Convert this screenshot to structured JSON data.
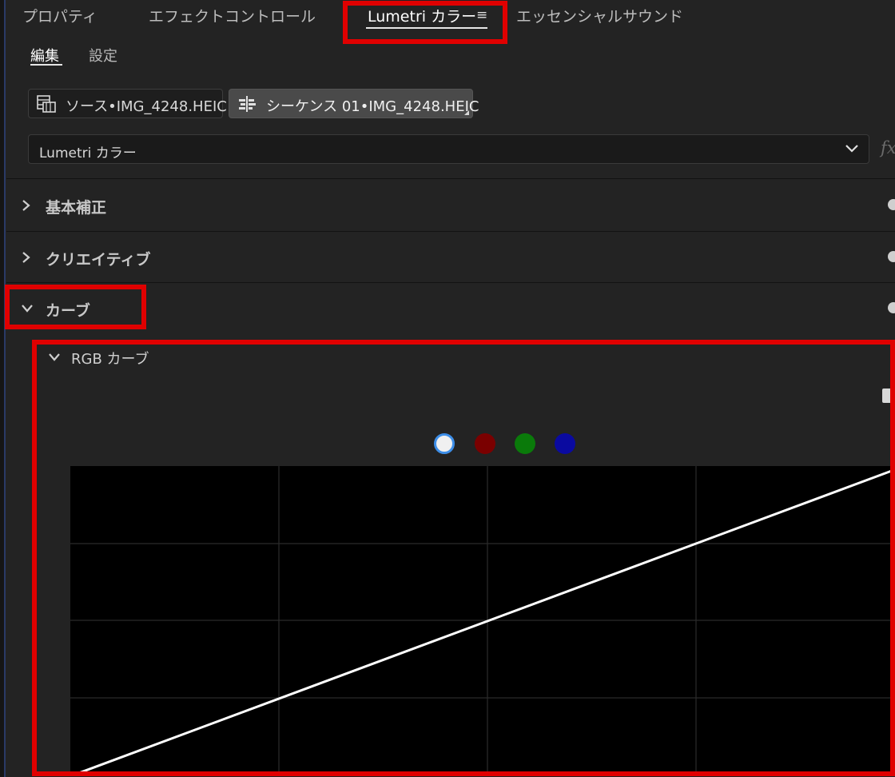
{
  "panel_tabs": [
    {
      "label": "プロパティ",
      "active": false
    },
    {
      "label": "エフェクトコントロール",
      "active": false
    },
    {
      "label": "Lumetri カラー",
      "active": true
    },
    {
      "label": "エッセンシャルサウンド",
      "active": false
    }
  ],
  "tab_menu_glyph": "≡",
  "sub_tabs": [
    {
      "label": "編集",
      "active": true
    },
    {
      "label": "設定",
      "active": false
    }
  ],
  "source_button": {
    "label": "ソース•IMG_4248.HEIC"
  },
  "sequence_button": {
    "label": "シーケンス 01•IMG_4248.HEIC",
    "selected": true
  },
  "effect_dropdown": {
    "value": "Lumetri カラー"
  },
  "fx_label": "fx",
  "sections": [
    {
      "label": "基本補正",
      "expanded": false
    },
    {
      "label": "クリエイティブ",
      "expanded": false
    },
    {
      "label": "カーブ",
      "expanded": true
    }
  ],
  "rgb_curve": {
    "title": "RGB カーブ",
    "channels": [
      {
        "name": "white",
        "color": "#f0f0f0",
        "selected": true
      },
      {
        "name": "red",
        "color": "#7a0000",
        "selected": false
      },
      {
        "name": "green",
        "color": "#0a7a0a",
        "selected": false
      },
      {
        "name": "blue",
        "color": "#0a0aa0",
        "selected": false
      }
    ],
    "curve_points": [
      [
        0,
        0
      ],
      [
        1,
        1
      ]
    ]
  },
  "colors": {
    "highlight": "#e00000",
    "panel_bg": "#232323",
    "graph_bg": "#000000",
    "grid": "#2b2b2b",
    "curve": "#ffffff",
    "selected_ring": "#3d8ee8"
  }
}
